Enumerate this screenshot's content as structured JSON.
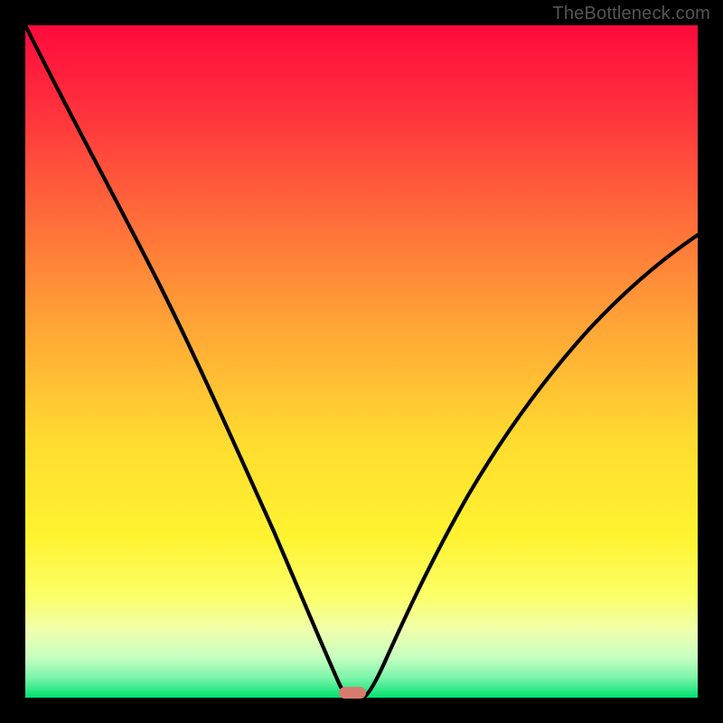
{
  "watermark": "TheBottleneck.com",
  "chart_data": {
    "type": "line",
    "title": "",
    "xlabel": "",
    "ylabel": "",
    "xlim": [
      0,
      100
    ],
    "ylim": [
      0,
      100
    ],
    "x": [
      0,
      5,
      10,
      15,
      20,
      25,
      30,
      35,
      40,
      45,
      47,
      48,
      50,
      52,
      55,
      60,
      65,
      70,
      75,
      80,
      85,
      90,
      95,
      100
    ],
    "values": [
      100,
      91,
      82,
      74,
      66,
      57,
      47,
      36,
      24,
      10,
      3,
      0,
      0,
      3,
      10,
      21,
      30,
      38,
      45,
      51,
      56,
      61,
      65,
      69
    ],
    "marker_x": 48,
    "background_gradient": {
      "top": "#ff1540",
      "mid_upper": "#ff7a3a",
      "mid": "#ffe038",
      "lower": "#fcff70",
      "near_bottom": "#c2ffb0",
      "bottom": "#00e878"
    },
    "curve_color": "#000000",
    "marker_color": "#d87b6f"
  }
}
